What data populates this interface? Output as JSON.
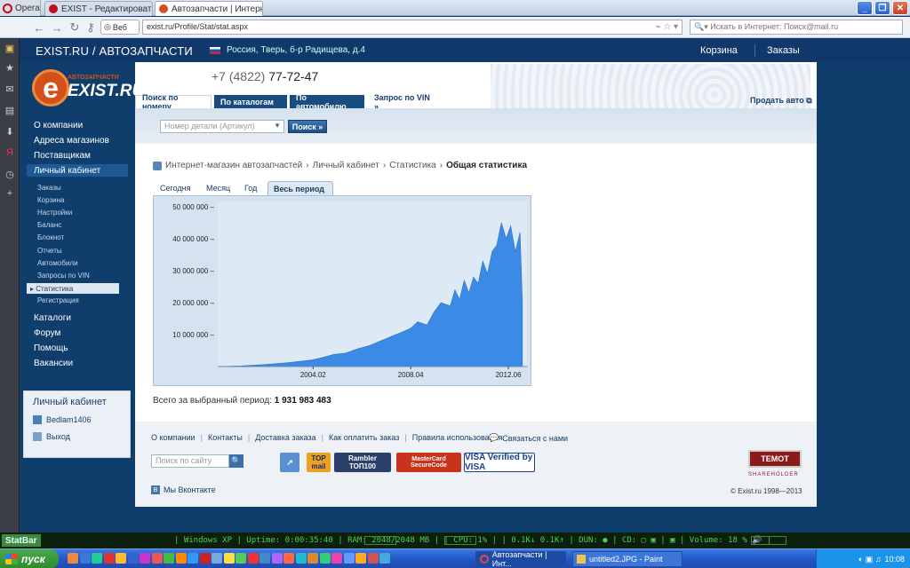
{
  "browser": {
    "opera_label": "Opera",
    "tabs": [
      {
        "title": "EXIST - Редактировать"
      },
      {
        "title": "Автозапчасти | Интерн..."
      }
    ],
    "web_button": "Веб",
    "url": "exist.ru/Profile/Stat/stat.aspx",
    "search_placeholder": "Искать в Интернет: Поиск@mail.ru"
  },
  "site": {
    "brand": "EXIST.RU / АВТОЗАПЧАСТИ",
    "location": "Россия, Тверь, б-р Радищева, д.4",
    "cart": "Корзина",
    "orders": "Заказы",
    "logo_small": "АВТОЗАПЧАСТИ",
    "logo_big": "EXIST.RU",
    "phone_prefix": "+7 (4822)",
    "phone_number": "77-72-47",
    "search_tabs": [
      "Поиск по номеру",
      "По каталогам",
      "По автомобилю",
      "Запрос по VIN »"
    ],
    "sell_car": "Продать авто",
    "part_placeholder": "Номер детали (Артикул)",
    "find_button": "Поиск »"
  },
  "leftnav": {
    "top": [
      "О компании",
      "Адреса магазинов",
      "Поставщикам",
      "Личный кабинет"
    ],
    "sub": [
      "Заказы",
      "Корзина",
      "Настройки",
      "Баланс",
      "Блокнот",
      "Отчеты",
      "Автомобили",
      "Запросы по VIN",
      "Статистика",
      "Регистрация"
    ],
    "bottom": [
      "Каталоги",
      "Форум",
      "Помощь",
      "Вакансии"
    ],
    "cabinet_title": "Личный кабинет",
    "user": "Bedlam1406",
    "logout": "Выход"
  },
  "breadcrumb": [
    "Интернет-магазин автозапчастей",
    "Личный кабинет",
    "Статистика",
    "Общая статистика"
  ],
  "period_tabs": [
    "Сегодня",
    "Месяц",
    "Год",
    "Весь период"
  ],
  "total_label": "Всего за выбранный период:",
  "total_value": "1 931 983 483",
  "chart_data": {
    "type": "area",
    "x_ticks": [
      "2004.02",
      "2008.04",
      "2012.06"
    ],
    "y_ticks": [
      "50 000 000 –",
      "40 000 000 –",
      "30 000 000 –",
      "20 000 000 –",
      "10 000 000 –"
    ],
    "ylim": [
      0,
      50000000
    ],
    "color": "#3b8ae6",
    "x": [
      2000.0,
      2001.0,
      2002.0,
      2003.0,
      2004.0,
      2004.5,
      2005.0,
      2005.5,
      2006.0,
      2006.5,
      2007.0,
      2007.5,
      2008.0,
      2008.3,
      2008.6,
      2009.0,
      2009.3,
      2009.6,
      2010.0,
      2010.2,
      2010.4,
      2010.6,
      2010.8,
      2011.0,
      2011.2,
      2011.4,
      2011.6,
      2011.8,
      2012.0,
      2012.2,
      2012.4,
      2012.6,
      2012.8,
      2013.0,
      2013.1
    ],
    "values": [
      0,
      200000,
      600000,
      1200000,
      2000000,
      2800000,
      3800000,
      4200000,
      5500000,
      6500000,
      8000000,
      9500000,
      11000000,
      12000000,
      14000000,
      13000000,
      17000000,
      20000000,
      19000000,
      24000000,
      21000000,
      27000000,
      23000000,
      28000000,
      26000000,
      33000000,
      29000000,
      36000000,
      38000000,
      45000000,
      40000000,
      44000000,
      36000000,
      42000000,
      20000000
    ]
  },
  "footer": {
    "links": [
      "О компании",
      "Контакты",
      "Доставка заказа",
      "Как оплатить заказ",
      "Правила использования"
    ],
    "contact": "Связаться с нами",
    "site_search_placeholder": "Поиск по сайту",
    "vk": "Мы Вконтакте",
    "temot": "TEMOT",
    "temot_sub": "INTERNATIONAL",
    "shareholder": "SHAREHOLDER",
    "copyright": "© Exist.ru 1998—2013",
    "badges": {
      "top_mail": "TOP mail",
      "rambler": "Rambler ТОП100",
      "mastercard": "MasterCard SecureCode",
      "visa": "VISA Verified by VISA"
    }
  },
  "statbar": {
    "logo": "StatBar",
    "text": "| Windows XP | Uptime: 0:00:35:40 | RAM: 2048/2048 MB |          | CPU:   1% |          |       0.1K↓   0.1K↑ | DUN: ● | CD: ▢ ▣ | ▣ | Volume:  18 % 🔊 |"
  },
  "taskbar": {
    "start": "пуск",
    "tasks": [
      "Автозапчасти | Инт...",
      "untitled2.JPG - Paint"
    ],
    "lang": "RU",
    "clock": "10:08"
  }
}
